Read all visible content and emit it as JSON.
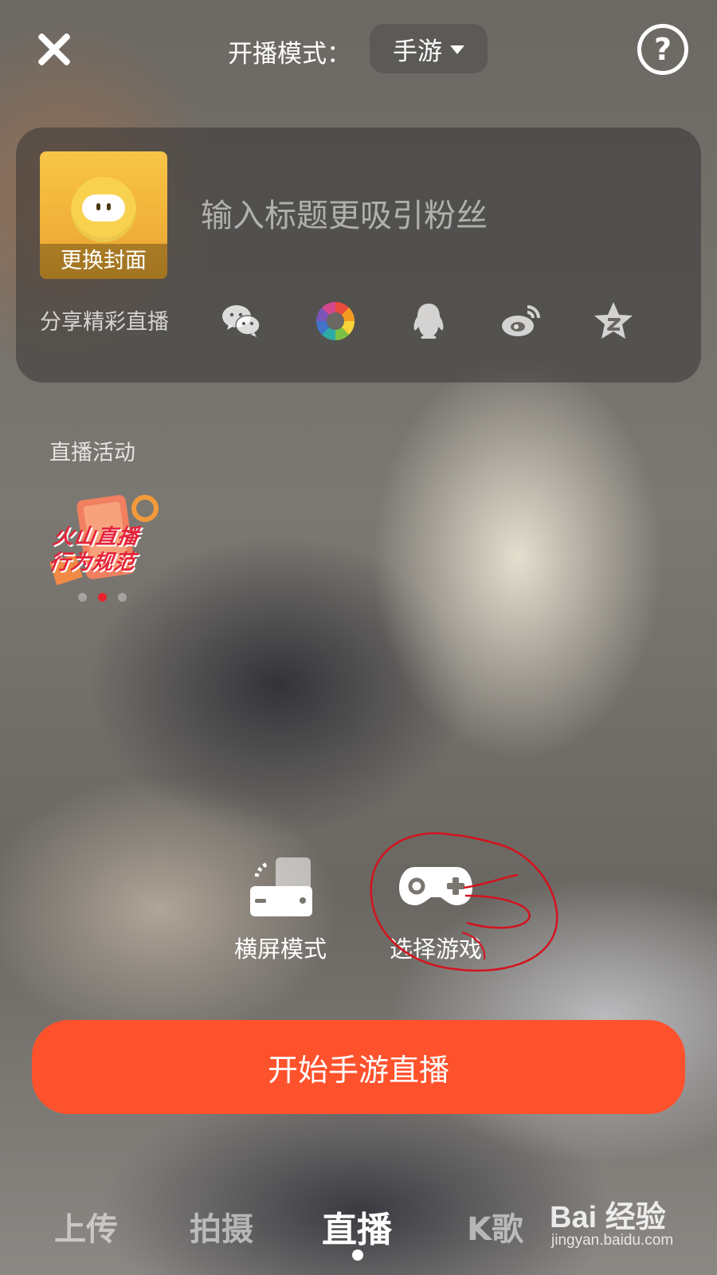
{
  "header": {
    "mode_label": "开播模式：",
    "mode_value": "手游",
    "help_glyph": "?"
  },
  "card": {
    "cover_label": "更换封面",
    "title_placeholder": "输入标题更吸引粉丝",
    "share_label": "分享精彩直播",
    "share_targets": [
      "wechat-icon",
      "moments-icon",
      "qq-icon",
      "weibo-icon",
      "qzone-icon"
    ]
  },
  "activity": {
    "label": "直播活动",
    "banner_line1": "火山直播",
    "banner_line2": "行为规范",
    "page_count": 3,
    "active_page": 2
  },
  "options": {
    "landscape_label": "横屏模式",
    "select_game_label": "选择游戏"
  },
  "start_button": "开始手游直播",
  "tabs": {
    "upload": "上传",
    "shoot": "拍摄",
    "live": "直播",
    "karaoke": "K歌",
    "active": "live"
  },
  "watermark": {
    "logo": "Bai 经验",
    "url": "jingyan.baidu.com"
  },
  "colors": {
    "accent": "#fe522d",
    "annotation": "#d4121e",
    "cover_yellow": "#f2b23a"
  }
}
